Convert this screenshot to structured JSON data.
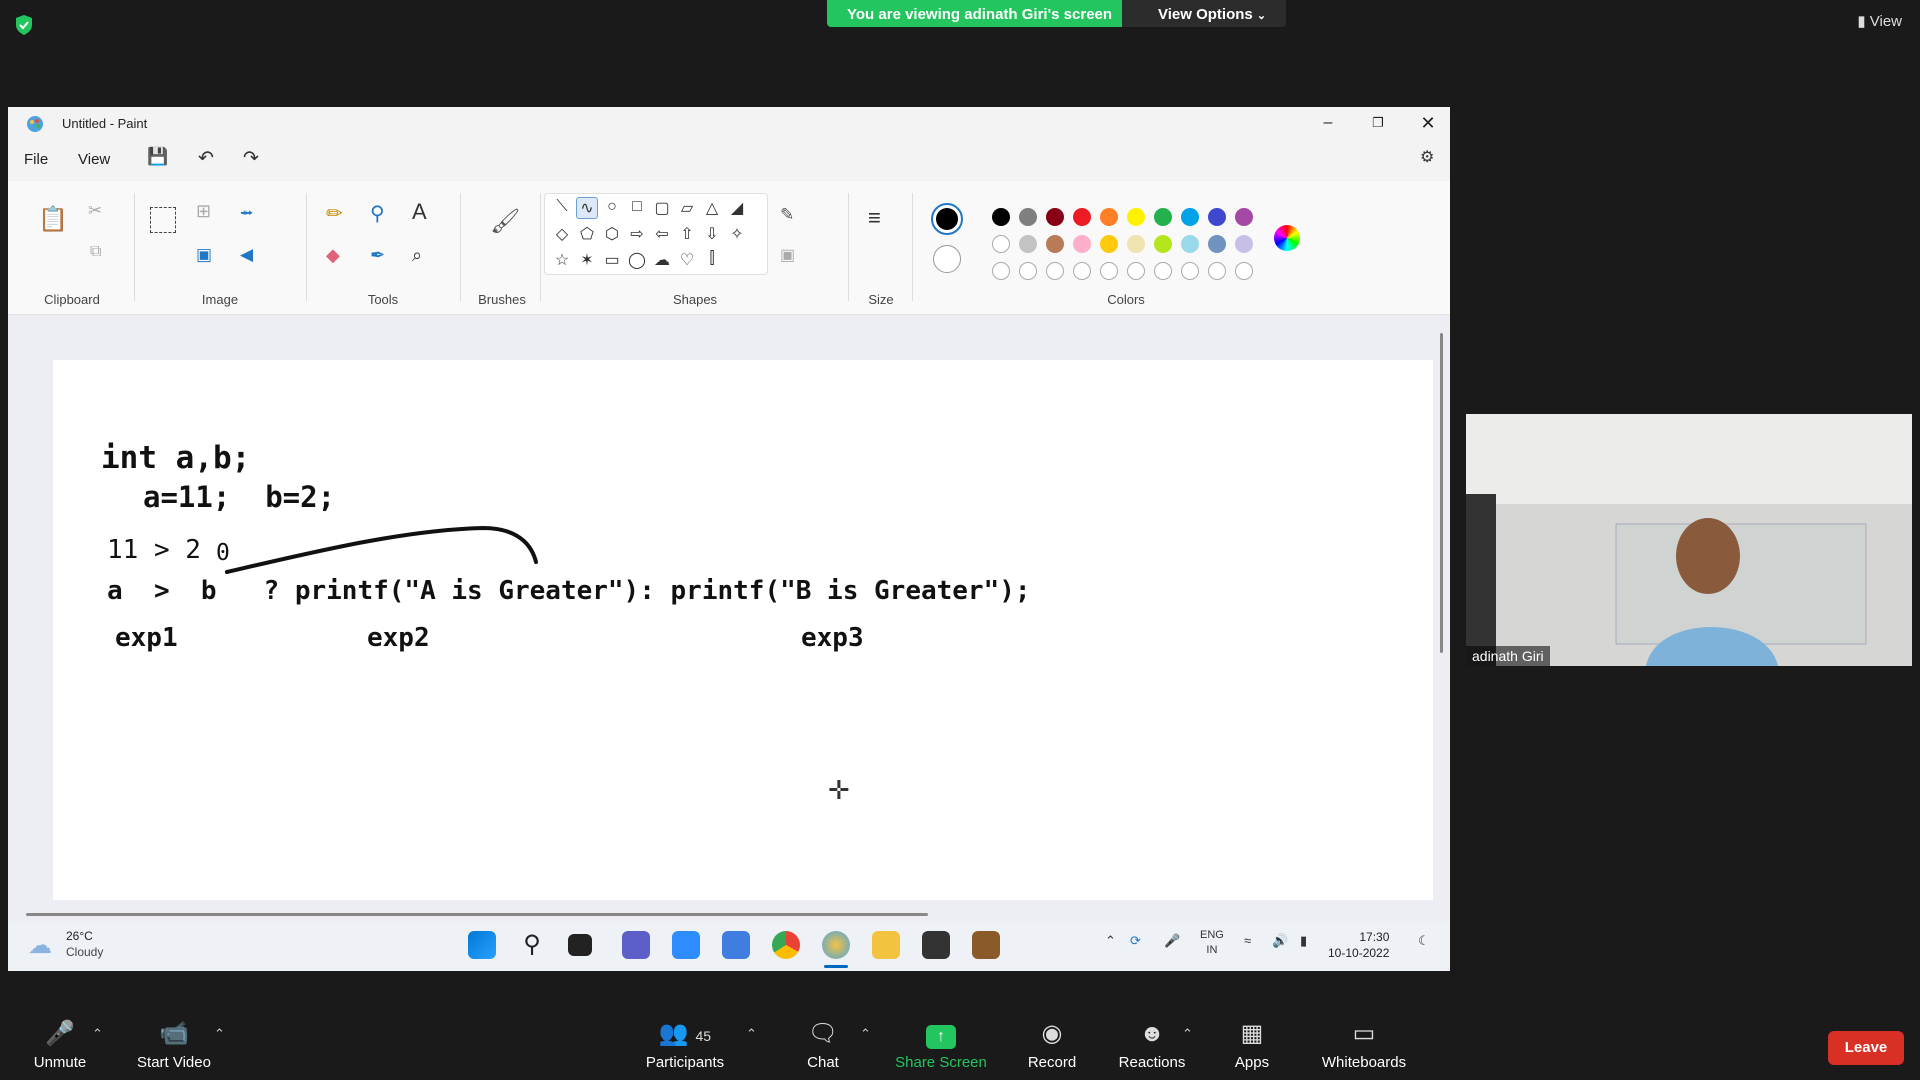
{
  "zoom": {
    "banner": "You are viewing adinath Giri's screen",
    "view_options": "View Options",
    "view_button": "View",
    "participant_name": "adinath Giri",
    "participants_count": "45",
    "toolbar": {
      "unmute": "Unmute",
      "start_video": "Start Video",
      "participants": "Participants",
      "chat": "Chat",
      "share_screen": "Share Screen",
      "record": "Record",
      "reactions": "Reactions",
      "apps": "Apps",
      "whiteboards": "Whiteboards",
      "leave": "Leave"
    },
    "colors": {
      "banner": "#23c55e",
      "leave": "#d93025",
      "share": "#23c55e"
    }
  },
  "paint": {
    "title": "Untitled - Paint",
    "menu": {
      "file": "File",
      "view": "View"
    },
    "groups": {
      "clipboard": "Clipboard",
      "image": "Image",
      "tools": "Tools",
      "brushes": "Brushes",
      "shapes": "Shapes",
      "size": "Size",
      "colors": "Colors"
    },
    "palette_row1": [
      "#000000",
      "#7f7f7f",
      "#880015",
      "#ed1c24",
      "#ff7f27",
      "#fff200",
      "#22b14c",
      "#00a2e8",
      "#3f48cc",
      "#a349a4"
    ],
    "palette_row2": [
      "#ffffff",
      "#c3c3c3",
      "#b97a57",
      "#ffaec9",
      "#ffc90e",
      "#efe4b0",
      "#b5e61d",
      "#99d9ea",
      "#7092be",
      "#c8bfe7"
    ],
    "canvas": {
      "line1": "int a,b;",
      "line2": "a=11;  b=2;",
      "line3": "11 > 2",
      "line3_extra": "0",
      "line4": "a  >  b   ? printf(\"A is Greater\"): printf(\"B is Greater\");",
      "exp1": "exp1",
      "exp2": "exp2",
      "exp3": "exp3"
    }
  },
  "taskbar": {
    "temp": "26°C",
    "condition": "Cloudy",
    "lang1": "ENG",
    "lang2": "IN",
    "time": "17:30",
    "date": "10-10-2022"
  }
}
